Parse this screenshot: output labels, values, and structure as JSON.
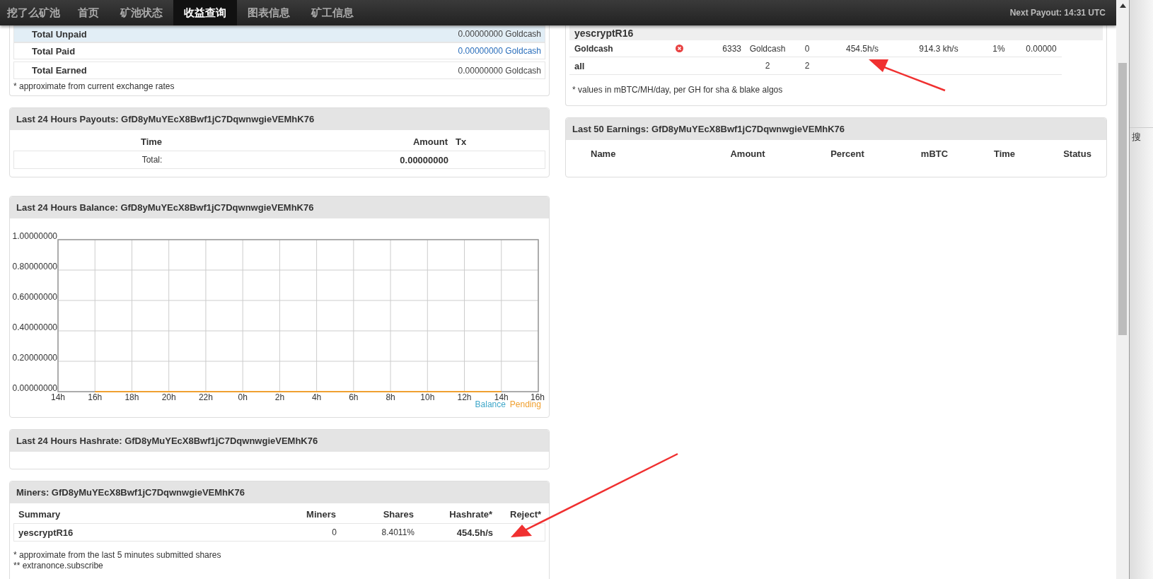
{
  "navbar": {
    "brand": "挖了么矿池",
    "items": [
      {
        "label": "首页",
        "selected": false
      },
      {
        "label": "矿池状态",
        "selected": false
      },
      {
        "label": "收益查询",
        "selected": true
      },
      {
        "label": "图表信息",
        "selected": false
      },
      {
        "label": "矿工信息",
        "selected": false
      }
    ],
    "next_payout": "Next Payout: 14:31 UTC"
  },
  "totals": {
    "rows": [
      {
        "label": "Total Unpaid",
        "value": "0.00000000 Goldcash",
        "highlighted": true,
        "link": false
      },
      {
        "label": "Total Paid",
        "value": "0.00000000 Goldcash",
        "highlighted": false,
        "link": true
      },
      {
        "label": "Total Earned",
        "value": "0.00000000 Goldcash",
        "highlighted": false,
        "link": false
      }
    ],
    "note": "* approximate from current exchange rates"
  },
  "payouts": {
    "title": "Last 24 Hours Payouts: GfD8yMuYEcX8Bwf1jC7DqwnwgieVEMhK76",
    "columns": [
      "Time",
      "Amount",
      "Tx"
    ],
    "total_label": "Total:",
    "total_amount": "0.00000000"
  },
  "balance": {
    "title": "Last 24 Hours Balance: GfD8yMuYEcX8Bwf1jC7DqwnwgieVEMhK76",
    "chart_data": {
      "type": "line",
      "grid": true,
      "categories": [
        "14h",
        "16h",
        "18h",
        "20h",
        "22h",
        "0h",
        "2h",
        "4h",
        "6h",
        "8h",
        "10h",
        "12h",
        "14h",
        "16h"
      ],
      "ylim": [
        0,
        1
      ],
      "yticks": [
        {
          "value": 0,
          "label": "0.00000000"
        },
        {
          "value": 0.2,
          "label": "0.20000000"
        },
        {
          "value": 0.4,
          "label": "0.40000000"
        },
        {
          "value": 0.6,
          "label": "0.60000000"
        },
        {
          "value": 0.8,
          "label": "0.80000000"
        },
        {
          "value": 1,
          "label": "1.00000000"
        }
      ],
      "series": [
        {
          "name": "Balance",
          "color": "#3fa7c9",
          "values": [
            null,
            null,
            null,
            null,
            null,
            null,
            null,
            null,
            null,
            null,
            null,
            null,
            null,
            null
          ]
        },
        {
          "name": "Pending",
          "color": "#f0a030",
          "values": [
            null,
            0,
            0,
            0,
            0,
            0,
            0,
            0,
            0,
            0,
            0,
            0,
            0,
            null
          ]
        }
      ]
    }
  },
  "hashrate": {
    "title": "Last 24 Hours Hashrate: GfD8yMuYEcX8Bwf1jC7DqwnwgieVEMhK76"
  },
  "miners": {
    "title": "Miners: GfD8yMuYEcX8Bwf1jC7DqwnwgieVEMhK76",
    "columns": [
      "Summary",
      "Miners",
      "Shares",
      "Hashrate*",
      "Reject*"
    ],
    "rows": [
      {
        "cells": [
          "yescryptR16",
          "0",
          "8.4011%",
          "454.5h/s"
        ]
      }
    ],
    "notes": [
      "* approximate from the last 5 minutes submitted shares",
      "** extranonce.subscribe"
    ]
  },
  "algo": {
    "title": "yescryptR16",
    "rows": [
      {
        "kind": "coin",
        "cells": [
          "Goldcash",
          "6333",
          "Goldcash",
          "0",
          "454.5h/s",
          "914.3 kh/s",
          "1%",
          "0.00000"
        ],
        "error": true
      },
      {
        "kind": "total",
        "cells": [
          "all",
          "",
          "2",
          "2"
        ],
        "error": false
      }
    ],
    "note": "* values in mBTC/MH/day, per GH for sha & blake algos"
  },
  "earnings": {
    "title": "Last 50 Earnings: GfD8yMuYEcX8Bwf1jC7DqwnwgieVEMhK76",
    "columns": [
      "Name",
      "Amount",
      "Percent",
      "mBTC",
      "Time",
      "Status"
    ]
  },
  "side_window": {
    "text": "搜"
  }
}
